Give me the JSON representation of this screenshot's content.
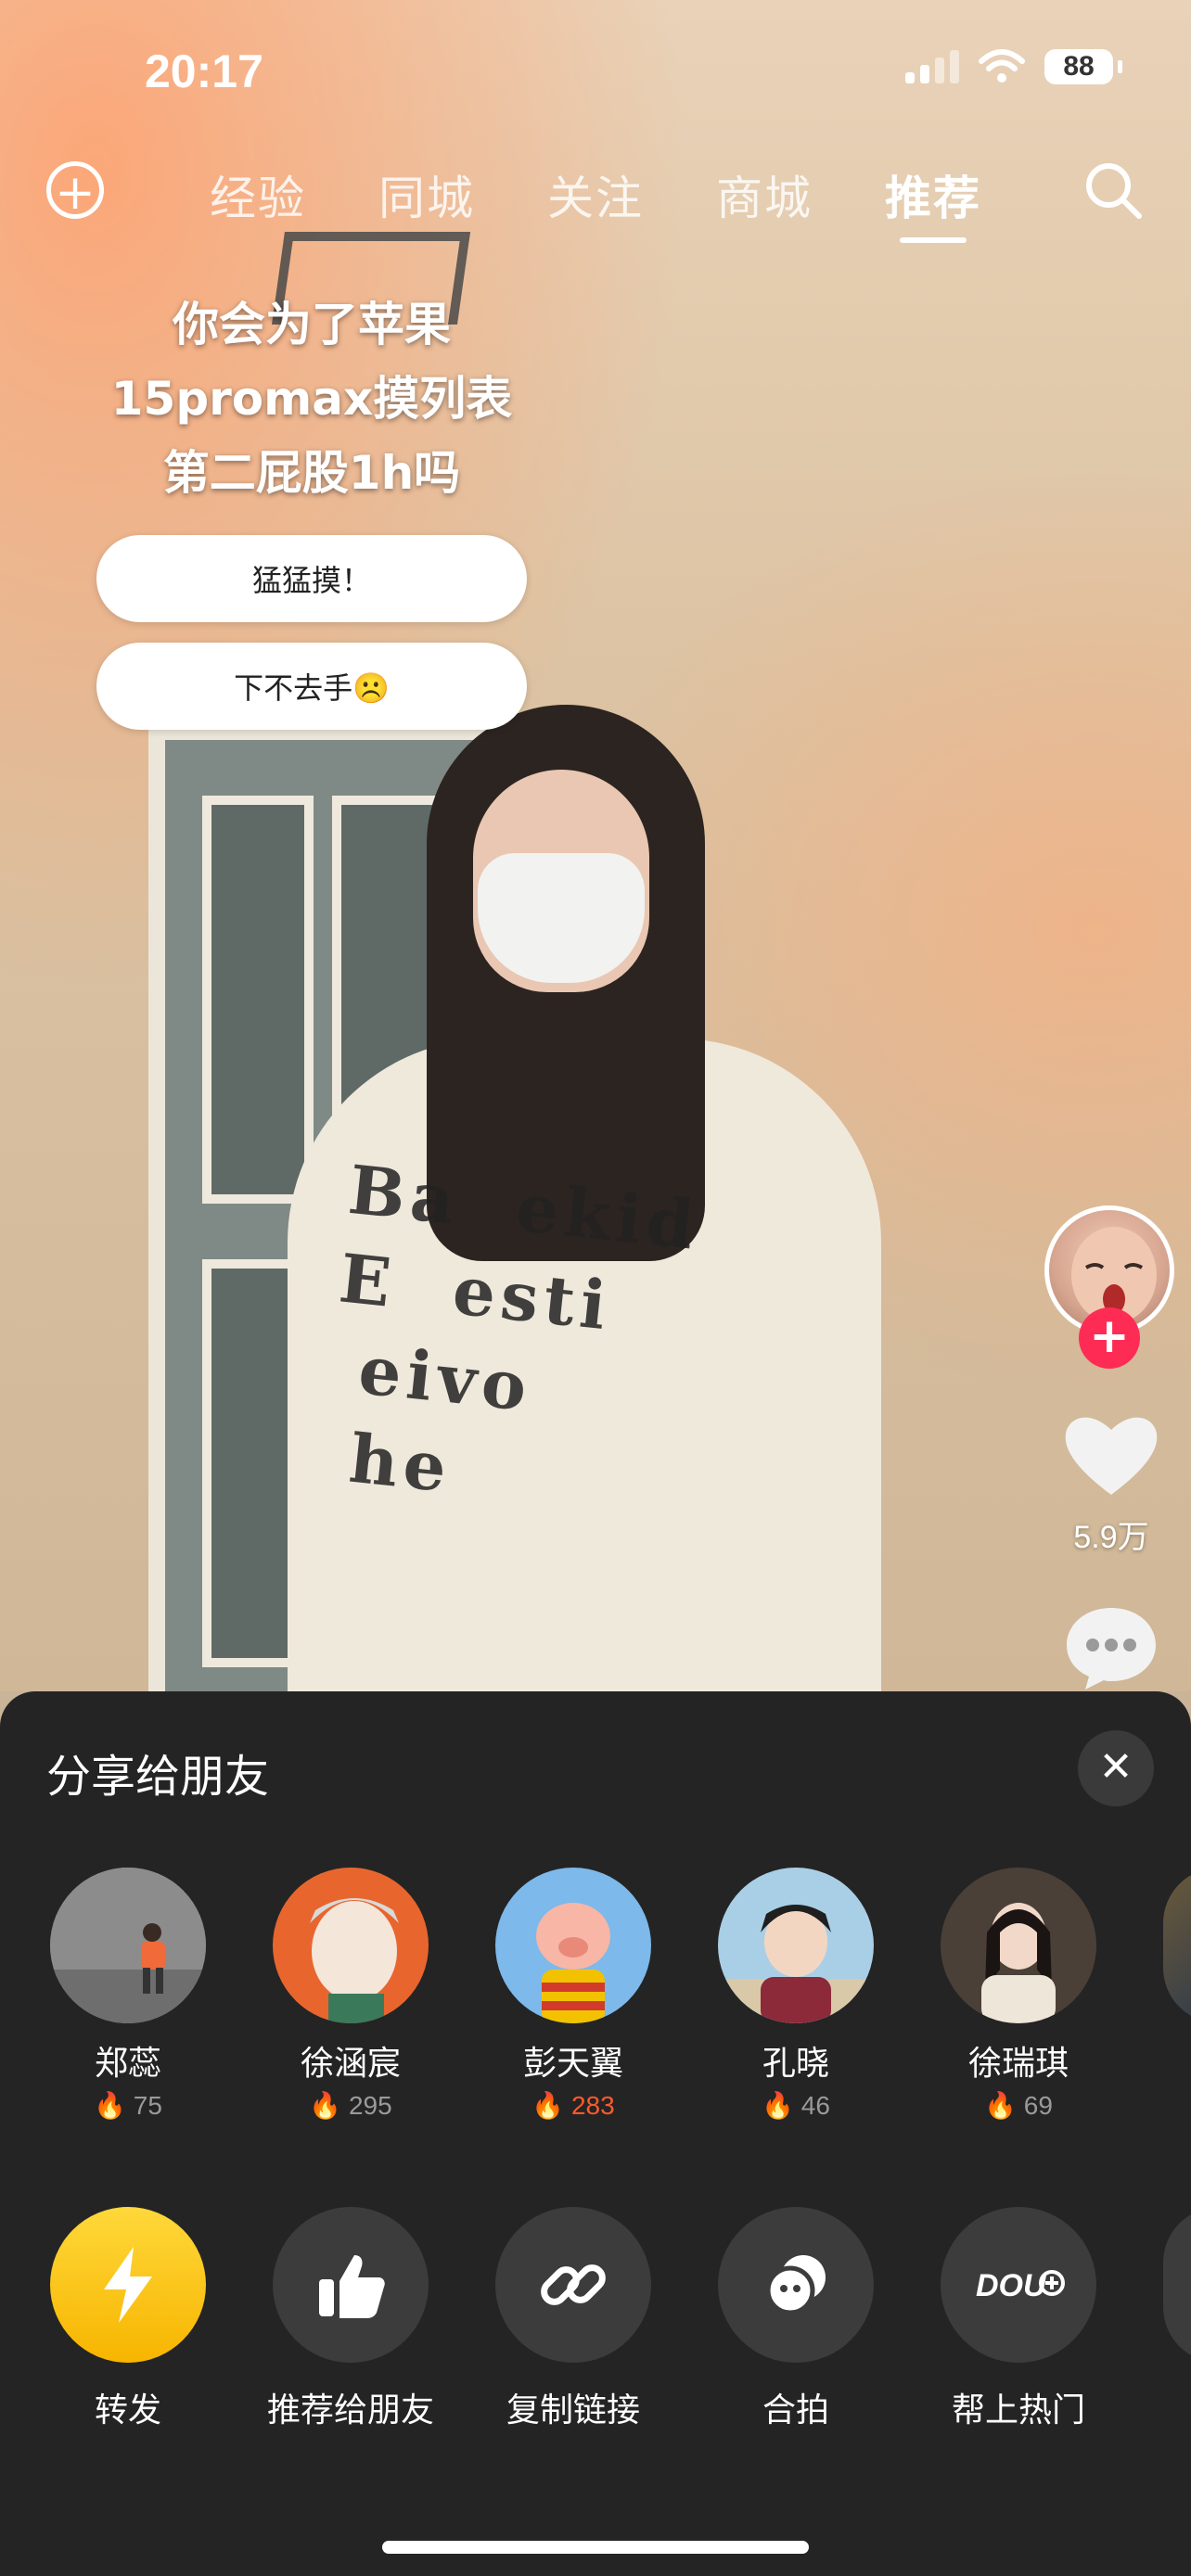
{
  "status_bar": {
    "time": "20:17",
    "battery": "88"
  },
  "top_nav": {
    "tabs": [
      "经验",
      "同城",
      "关注",
      "商城",
      "推荐"
    ],
    "active_tab": "推荐"
  },
  "poll": {
    "question_lines": [
      "你会为了苹果",
      "15promax摸列表",
      "第二屁股1h吗"
    ],
    "options": [
      "猛猛摸！",
      "下不去手☹️"
    ]
  },
  "side_actions": {
    "like_count": "5.9万"
  },
  "share_sheet": {
    "title": "分享给朋友",
    "friends": [
      {
        "name": "郑蕊",
        "fire": "75",
        "hot": false
      },
      {
        "name": "徐涵宸",
        "fire": "295",
        "hot": false
      },
      {
        "name": "彭天翼",
        "fire": "283",
        "hot": true
      },
      {
        "name": "孔晓",
        "fire": "46",
        "hot": false
      },
      {
        "name": "徐瑞琪",
        "fire": "69",
        "hot": false
      }
    ],
    "actions": [
      {
        "label": "转发",
        "icon": "lightning-icon"
      },
      {
        "label": "推荐给朋友",
        "icon": "thumbs-up-icon"
      },
      {
        "label": "复制链接",
        "icon": "link-icon"
      },
      {
        "label": "合拍",
        "icon": "duet-icon"
      },
      {
        "label": "帮上热门",
        "icon": "dou-plus-icon"
      }
    ]
  },
  "colors": {
    "accent_red": "#fe2c55",
    "fire_hot": "#ff5a2b",
    "sheet_bg": "#242424",
    "forward_yellow": "#ffc20e"
  }
}
